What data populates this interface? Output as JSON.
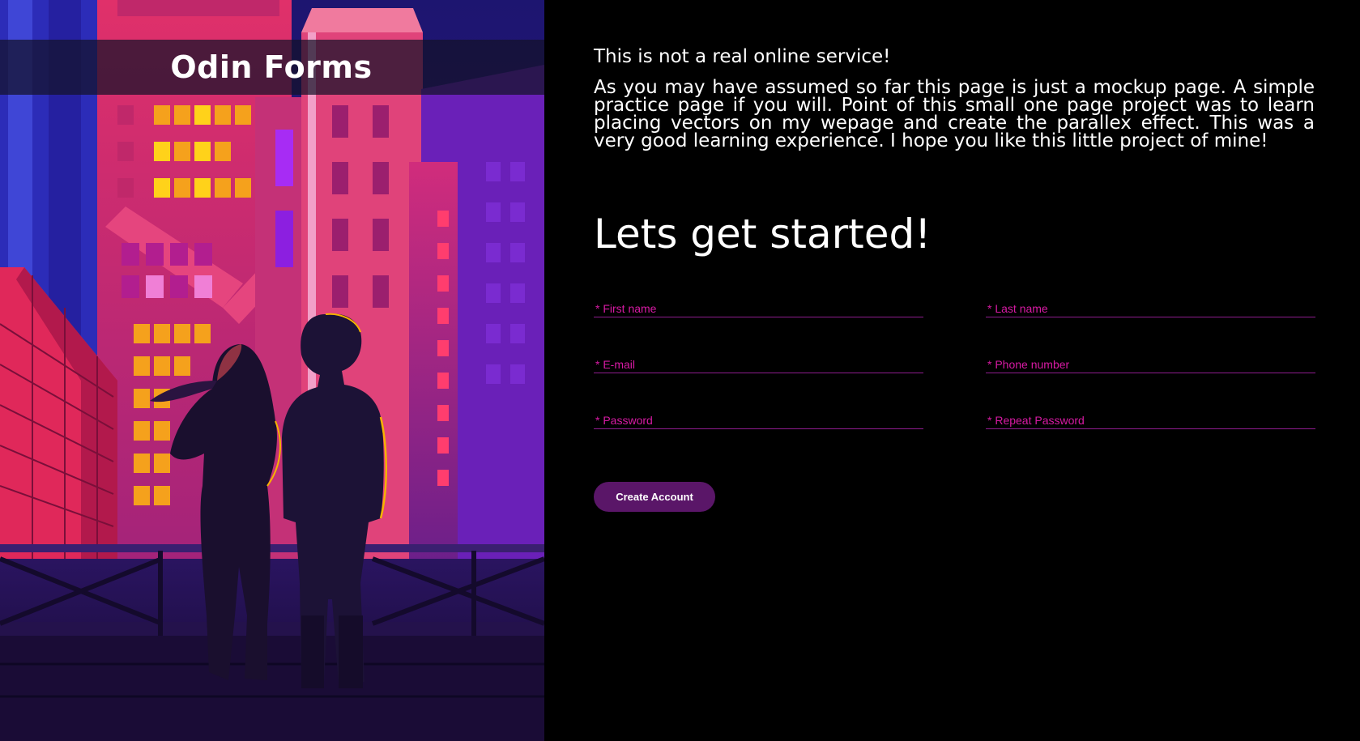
{
  "brand": {
    "title": "Odin Forms"
  },
  "intro": {
    "heading": "This is not a real online service!",
    "body": "As you may have assumed so far this page is just a mockup page. A simple practice page if you will. Point of this small one page project was to learn placing vectors on my wepage and create the parallex effect. This was a very good learning experience. I hope you like this little project of mine!"
  },
  "signup": {
    "title": "Lets get started!",
    "fields": {
      "first_name": "* First name",
      "last_name": "* Last name",
      "email": "* E-mail",
      "phone": "* Phone number",
      "password": "* Password",
      "repeat_password": "* Repeat Password"
    },
    "submit_label": "Create Account"
  },
  "hero_image": {
    "description_icon": "city-couple-illustration"
  },
  "colors": {
    "background": "#000000",
    "accent": "#d81aa4",
    "underline": "#8e1c8e",
    "button": "#5a1668",
    "brand_bar": "#141228"
  }
}
